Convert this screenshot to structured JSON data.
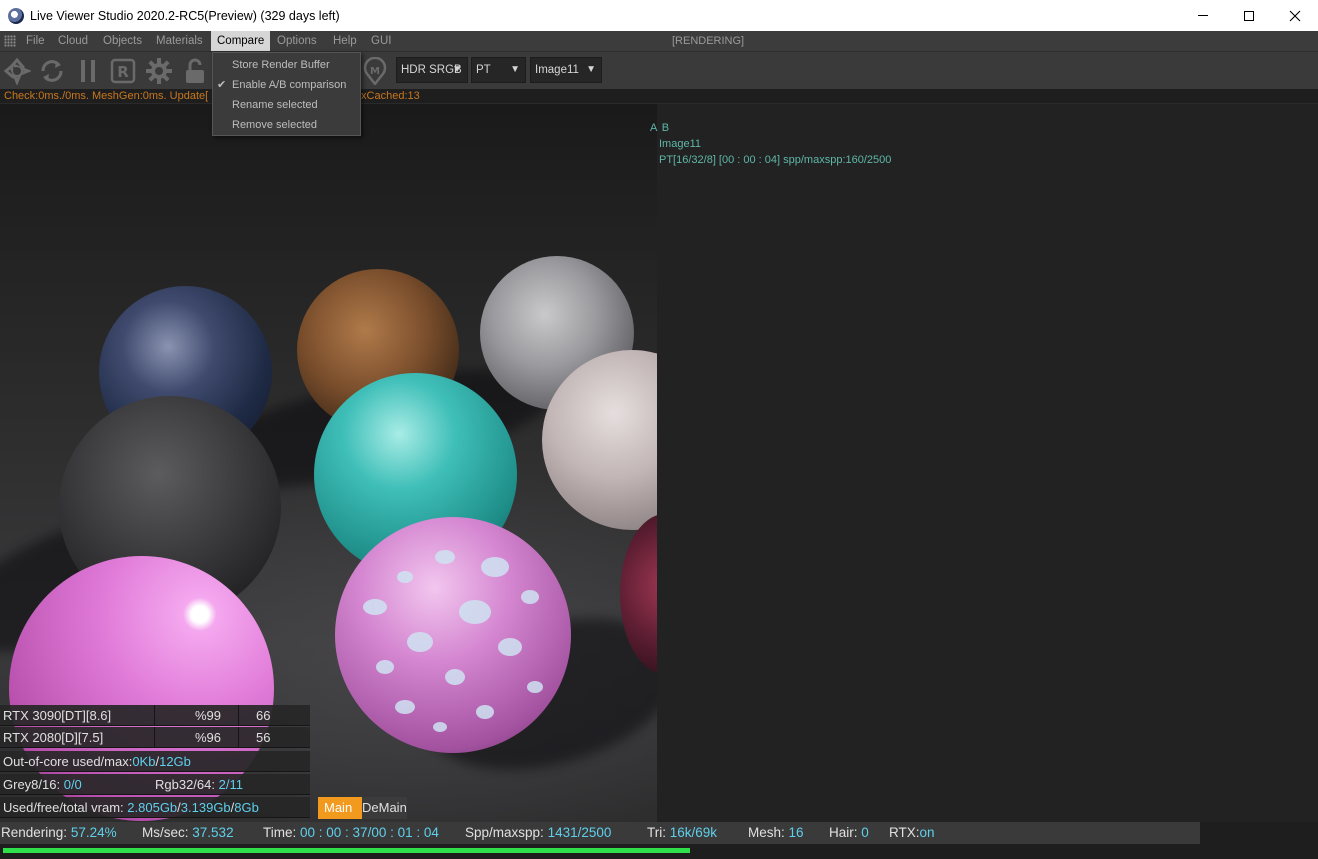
{
  "window": {
    "title": "Live Viewer Studio 2020.2-RC5(Preview) (329 days left)",
    "minimize_icon": "minimize-icon",
    "maximize_icon": "maximize-icon",
    "close_icon": "close-icon"
  },
  "menubar": {
    "items": [
      "File",
      "Cloud",
      "Objects",
      "Materials",
      "Compare",
      "Options",
      "Help",
      "GUI"
    ],
    "active": "Compare",
    "status": "[RENDERING]"
  },
  "toolbar": {
    "icons": [
      "aperture-icon",
      "refresh-icon",
      "pause-icon",
      "r-icon",
      "gear-icon",
      "lock-icon",
      "m-pin-icon"
    ],
    "color_space": "HDR SRGB",
    "kernel": "PT",
    "image": "Image11"
  },
  "compare_menu": {
    "items": [
      {
        "label": "Store Render Buffer",
        "checked": false
      },
      {
        "label": "Enable A/B comparison",
        "checked": true
      },
      {
        "label": "Rename selected",
        "checked": false
      },
      {
        "label": "Remove selected",
        "checked": false
      }
    ]
  },
  "infoline": {
    "left": "Check:0ms./0ms. MeshGen:0ms. Update[",
    "right": "txCached:13"
  },
  "ab_panel": {
    "label": "A B",
    "image_name": "Image11",
    "info": "PT[16/32/8] [00 : 00 : 04] spp/maxspp:160/2500"
  },
  "stats": {
    "gpus": [
      {
        "name": "RTX 3090[DT][8.6]",
        "usage": "%99",
        "temp": "66"
      },
      {
        "name": "RTX 2080[D][7.5]",
        "usage": "%96",
        "temp": "56"
      }
    ],
    "out_of_core": {
      "label": "Out-of-core used/max:",
      "value": "0Kb",
      "max": "12Gb"
    },
    "grey": {
      "label": "Grey8/16:",
      "value": "0/0"
    },
    "rgb": {
      "label": "Rgb32/64:",
      "value": "2/11"
    },
    "vram": {
      "label": "Used/free/total vram:",
      "used": "2.805Gb",
      "free": "3.139Gb",
      "total": "8Gb"
    },
    "tabs": [
      "Main",
      "DeMain"
    ]
  },
  "statusbar": {
    "rendering_label": "Rendering:",
    "rendering_value": "57.24%",
    "ms_label": "Ms/sec:",
    "ms_value": "37.532",
    "time_label": "Time:",
    "time_value": "00 : 00 : 37/00 : 01 : 04",
    "spp_label": "Spp/maxspp:",
    "spp_value": "1431/2500",
    "tri_label": "Tri:",
    "tri_value": "16k/69k",
    "mesh_label": "Mesh:",
    "mesh_value": "16",
    "hair_label": "Hair:",
    "hair_value": "0",
    "rtx_label": "RTX:",
    "rtx_value": "on",
    "progress": 0.5724
  },
  "colors": {
    "accent_teal": "#5fb7a8",
    "highlight_cyan": "#5fd0ec",
    "info_orange": "#c8781e",
    "tab_orange": "#f29a1d",
    "progress_green": "#2ee04a"
  }
}
